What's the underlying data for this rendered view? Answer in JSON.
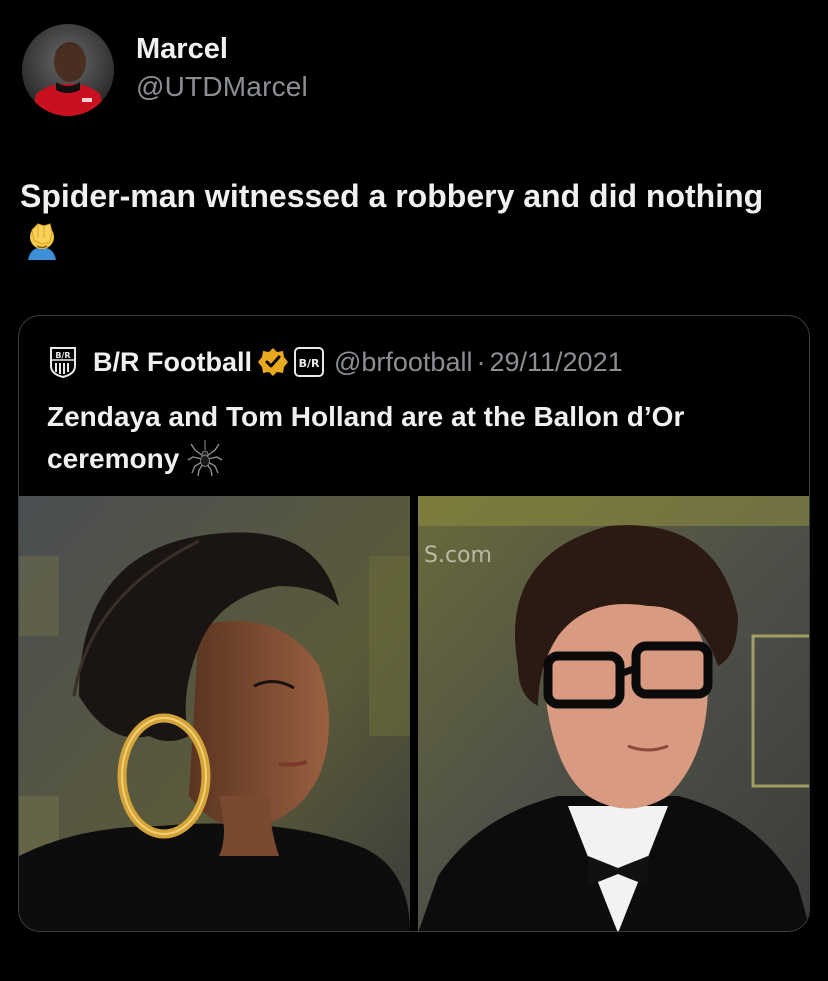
{
  "tweet": {
    "author_name": "Marcel",
    "author_handle": "@UTDMarcel",
    "text": "Spider-man witnessed a robbery and did nothing",
    "text_emoji": "facepalm-icon"
  },
  "quote": {
    "author_name": "B/R Football",
    "author_handle": "@brfootball",
    "separator": "·",
    "date": "29/11/2021",
    "text": "Zendaya and Tom Holland are at the Ballon d’Or ceremony",
    "text_emoji": "spider-icon",
    "logo_text": "B/R",
    "verified_color": "#e8a920"
  },
  "colors": {
    "background": "#000000",
    "text_primary": "#e7e9ea",
    "text_secondary": "#8b8f94",
    "border": "#3a3d41"
  }
}
